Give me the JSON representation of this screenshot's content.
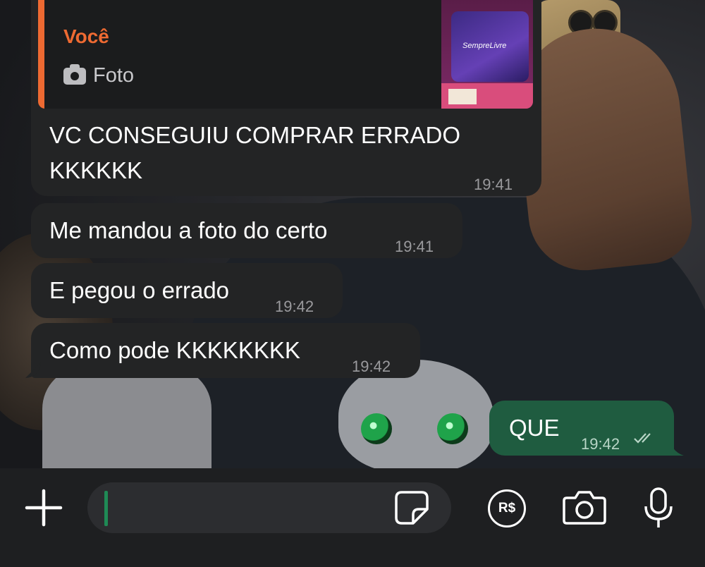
{
  "conversation": {
    "reply_message": {
      "quoted_sender": "Você",
      "quoted_type": "Foto",
      "text_line1": "VC CONSEGUIU COMPRAR ERRADO",
      "text_line2": "KKKKKK",
      "time": "19:41"
    },
    "messages": [
      {
        "text": "Me mandou a foto do certo",
        "time": "19:41"
      },
      {
        "text": "E pegou o errado",
        "time": "19:42"
      },
      {
        "text": "Como pode KKKKKKKK",
        "time": "19:42"
      }
    ],
    "outgoing": {
      "text": "QUE",
      "time": "19:42",
      "status": "read"
    }
  },
  "thumbnail": {
    "brand_text": "SempreLivre"
  },
  "composer": {
    "input_value": "",
    "icons": [
      "plus-icon",
      "sticker-icon",
      "payment-icon",
      "camera-icon",
      "microphone-icon"
    ],
    "payment_label": "R$"
  },
  "colors": {
    "incoming_bubble": "#232425",
    "outgoing_bubble": "#1f5c40",
    "quote_accent": "#ee6a32",
    "composer_bar": "#1e1f21",
    "input_bg": "#2c2d30"
  }
}
